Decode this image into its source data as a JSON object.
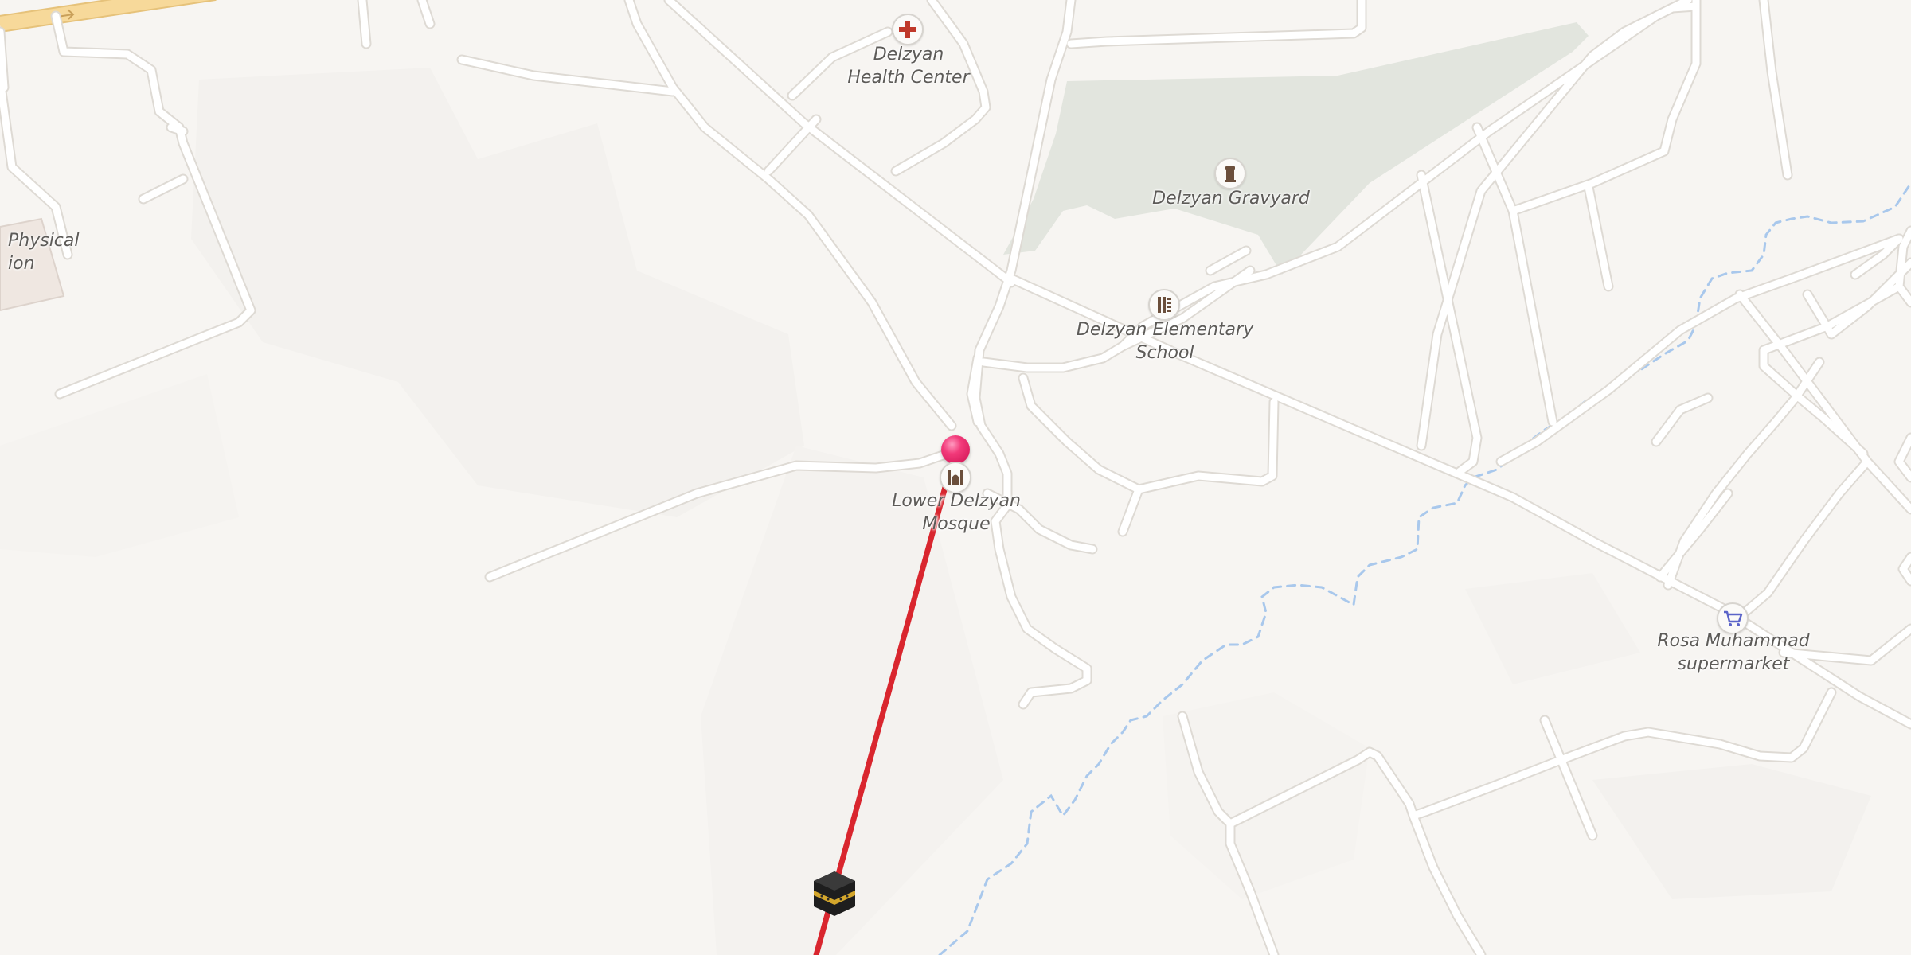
{
  "map": {
    "labels": {
      "health_center": [
        "Delzyan",
        "Health Center"
      ],
      "graveyard": [
        "Delzyan Gravyard"
      ],
      "school": [
        "Delzyan Elementary",
        "School"
      ],
      "mosque": [
        "Lower Delzyan",
        "Mosque"
      ],
      "supermarket": [
        "Rosa Muhammad",
        "supermarket"
      ],
      "physical": [
        "Physical",
        "ion"
      ]
    },
    "icons": {
      "health_center": "medical-cross-icon",
      "graveyard": "grave-icon",
      "school": "school-icon",
      "mosque": "mosque-icon",
      "supermarket": "shopping-cart-icon",
      "location_pin": "location-pin-icon",
      "kaaba": "kaaba-icon"
    },
    "colors": {
      "background": "#f7f5f2",
      "road": "#ffffff",
      "road_outline": "#dedad4",
      "main_road": "#f7d99a",
      "park": "#e2e5de",
      "river": "#a9c8ec",
      "qibla_line": "#d9262e",
      "pin": "#e8296b",
      "cart": "#5b64c9",
      "medical": "#c0392b"
    }
  }
}
